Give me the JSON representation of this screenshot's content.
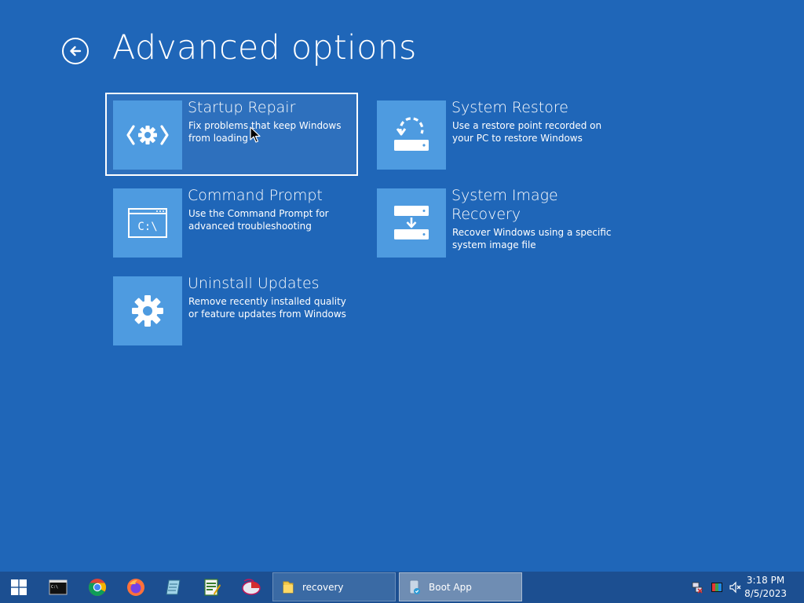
{
  "page": {
    "title": "Advanced options"
  },
  "options": [
    {
      "title": "Startup Repair",
      "description": "Fix problems that keep Windows from loading",
      "icon": "startup-repair-icon",
      "selected": true
    },
    {
      "title": "System Restore",
      "description": "Use a restore point recorded on your PC to restore Windows",
      "icon": "system-restore-icon",
      "selected": false
    },
    {
      "title": "Command Prompt",
      "description": "Use the Command Prompt for advanced troubleshooting",
      "icon": "command-prompt-icon",
      "selected": false
    },
    {
      "title": "System Image Recovery",
      "description": "Recover Windows using a specific system image file",
      "icon": "system-image-recovery-icon",
      "selected": false
    },
    {
      "title": "Uninstall Updates",
      "description": "Remove recently installed quality or feature updates from Windows",
      "icon": "uninstall-updates-icon",
      "selected": false
    }
  ],
  "taskbar": {
    "tasks": [
      {
        "label": "recovery",
        "icon": "folder-icon"
      },
      {
        "label": "Boot App",
        "icon": "boot-app-icon"
      }
    ],
    "clock": {
      "time": "3:18 PM",
      "date": "8/5/2023"
    }
  },
  "colors": {
    "background": "#1f66b8",
    "tile": "#4e9be0",
    "taskbar": "#1c4f91"
  }
}
